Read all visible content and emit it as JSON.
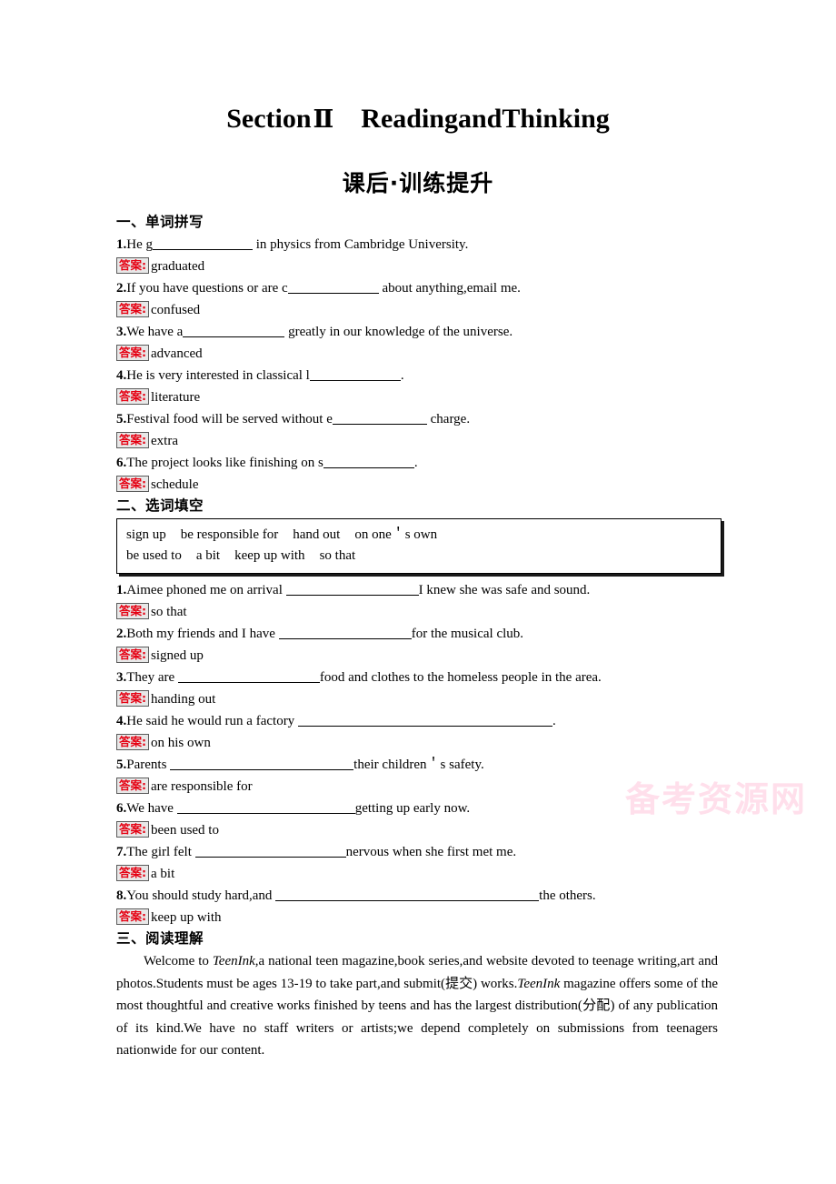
{
  "header": {
    "section_label": "Section",
    "section_number": "Ⅱ",
    "section_title": "ReadingandThinking",
    "subtitle": "课后·训练提升"
  },
  "watermark": {
    "text": "备考资源网"
  },
  "answer_tag": "答案:",
  "sections": [
    {
      "heading": "一、单词拼写",
      "type": "spelling",
      "items": [
        {
          "num": "1.",
          "before": "He g",
          "blank_w": 110,
          "after": " in physics from Cambridge University.",
          "answer": "graduated"
        },
        {
          "num": "2.",
          "before": "If you have questions or are c",
          "blank_w": 100,
          "after": " about anything,email me.",
          "answer": "confused"
        },
        {
          "num": "3.",
          "before": "We have a",
          "blank_w": 112,
          "after": " greatly in our knowledge of the universe.",
          "answer": "advanced"
        },
        {
          "num": "4.",
          "before": "He is very interested in classical l",
          "blank_w": 100,
          "after": ".",
          "answer": "literature"
        },
        {
          "num": "5.",
          "before": "Festival food will be served without e",
          "blank_w": 104,
          "after": " charge.",
          "answer": "extra"
        },
        {
          "num": "6.",
          "before": "The project looks like finishing on s",
          "blank_w": 100,
          "after": ".",
          "answer": "schedule"
        }
      ]
    },
    {
      "heading": "二、选词填空",
      "type": "word-bank",
      "bank": [
        [
          "sign up",
          "be responsible for",
          "hand out",
          "on one＇s own"
        ],
        [
          "be used to",
          "a bit",
          "keep up with",
          "so that"
        ]
      ],
      "items": [
        {
          "num": "1.",
          "before": "Aimee phoned me on arrival ",
          "blank_w": 146,
          "after": "I knew she was safe and sound.",
          "answer": "so that"
        },
        {
          "num": "2.",
          "before": "Both my friends and I have ",
          "blank_w": 146,
          "after": "for the musical club.",
          "answer": "signed up"
        },
        {
          "num": "3.",
          "before": "They are ",
          "blank_w": 156,
          "after": "food and clothes to the homeless people in the area.",
          "answer": "handing out"
        },
        {
          "num": "4.",
          "before": "He said he would run a factory ",
          "blank_w": 280,
          "after": ".",
          "answer": "on his own"
        },
        {
          "num": "5.",
          "before": "Parents ",
          "blank_w": 202,
          "after": "their children＇s safety.",
          "answer": "are responsible for"
        },
        {
          "num": "6.",
          "before": "We have ",
          "blank_w": 196,
          "after": "getting up early now.",
          "answer": "been used to"
        },
        {
          "num": "7.",
          "before": "The girl felt ",
          "blank_w": 166,
          "after": "nervous when she first met me.",
          "answer": "a bit"
        },
        {
          "num": "8.",
          "before": "You should study hard,and ",
          "blank_w": 290,
          "after": "the others.",
          "answer": "keep up with"
        }
      ]
    },
    {
      "heading": "三、阅读理解",
      "type": "reading",
      "passage_parts": [
        {
          "text": "Welcome to ",
          "italic": false
        },
        {
          "text": "TeenInk",
          "italic": true
        },
        {
          "text": ",a national teen magazine,book series,and website devoted to teenage writing,art and photos.Students must be ages 13-19 to take part,and submit(提交) works.",
          "italic": false
        },
        {
          "text": "TeenInk",
          "italic": true
        },
        {
          "text": " magazine offers some of the most thoughtful and creative works finished by teens and has the largest distribution(分配) of any publication of its kind.We have no staff writers or artists;we depend completely on submissions from teenagers nationwide for our content.",
          "italic": false
        }
      ]
    }
  ]
}
